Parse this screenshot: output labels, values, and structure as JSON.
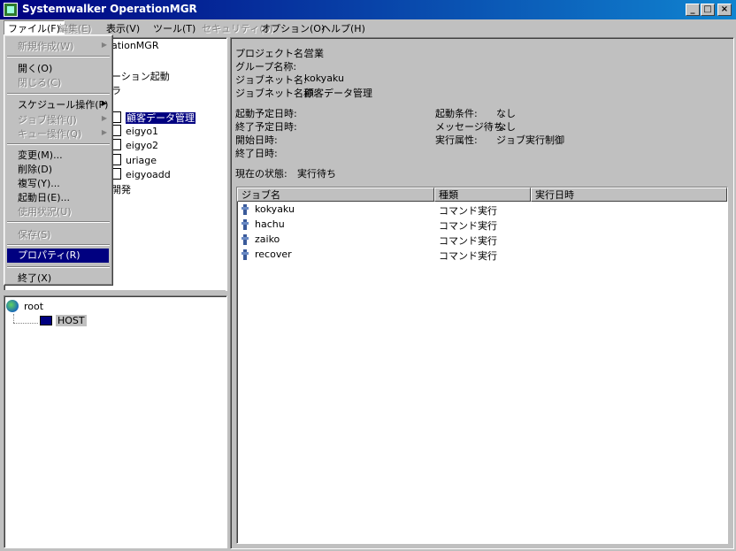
{
  "window": {
    "title": "Systemwalker OperationMGR",
    "min": "_",
    "max": "□",
    "close": "×"
  },
  "menubar": [
    {
      "label": "ファイル(F)",
      "disabled": false
    },
    {
      "label": "編集(E)",
      "disabled": true
    },
    {
      "label": "表示(V)",
      "disabled": false
    },
    {
      "label": "ツール(T)",
      "disabled": false
    },
    {
      "label": "セキュリティ(S)",
      "disabled": true
    },
    {
      "label": "オプション(O)",
      "disabled": false
    },
    {
      "label": "ヘルプ(H)",
      "disabled": false
    }
  ],
  "file_menu": {
    "new": "新規作成(W)",
    "open": "開く(O)",
    "close": "閉じる(C)",
    "schedule_op": "スケジュール操作(P)",
    "job_op": "ジョブ操作(J)",
    "queue_op": "キュー操作(Q)",
    "modify": "変更(M)...",
    "delete": "削除(D)",
    "copy": "複写(Y)...",
    "start_date": "起動日(E)...",
    "usage": "使用状況(U)",
    "save": "保存(S)",
    "property": "プロパティ(R)",
    "exit": "終了(X)"
  },
  "tree": {
    "root_partial": "ationMGR",
    "item2_partial": "ーション起動",
    "item3_partial": "ラ",
    "selected": "顧客データ管理",
    "items": [
      "eigyo1",
      "eigyo2",
      "uriage",
      "eigyoadd"
    ],
    "last_partial": "開発"
  },
  "host_tree": {
    "root": "root",
    "host": "HOST"
  },
  "properties": {
    "project_label": "プロジェクト名:",
    "project_value": "営業",
    "group_label": "グループ名称:",
    "jobnet_label": "ジョブネット名:",
    "jobnet_value": "kokyaku",
    "jobnet_name_label": "ジョブネット名称:",
    "jobnet_name_value": "顧客データ管理",
    "sched_start_label": "起動予定日時:",
    "sched_end_label": "終了予定日時:",
    "start_label": "開始日時:",
    "end_label": "終了日時:",
    "cond_label": "起動条件:",
    "cond_value": "なし",
    "msg_label": "メッセージ待ち:",
    "msg_value": "なし",
    "attr_label": "実行属性:",
    "attr_value": "ジョブ実行制御",
    "status_label": "現在の状態:",
    "status_value": "実行待ち"
  },
  "job_table": {
    "columns": [
      "ジョブ名",
      "種類",
      "実行日時"
    ],
    "rows": [
      {
        "name": "kokyaku",
        "type": "コマンド実行"
      },
      {
        "name": "hachu",
        "type": "コマンド実行"
      },
      {
        "name": "zaiko",
        "type": "コマンド実行"
      },
      {
        "name": "recover",
        "type": "コマンド実行"
      }
    ]
  }
}
